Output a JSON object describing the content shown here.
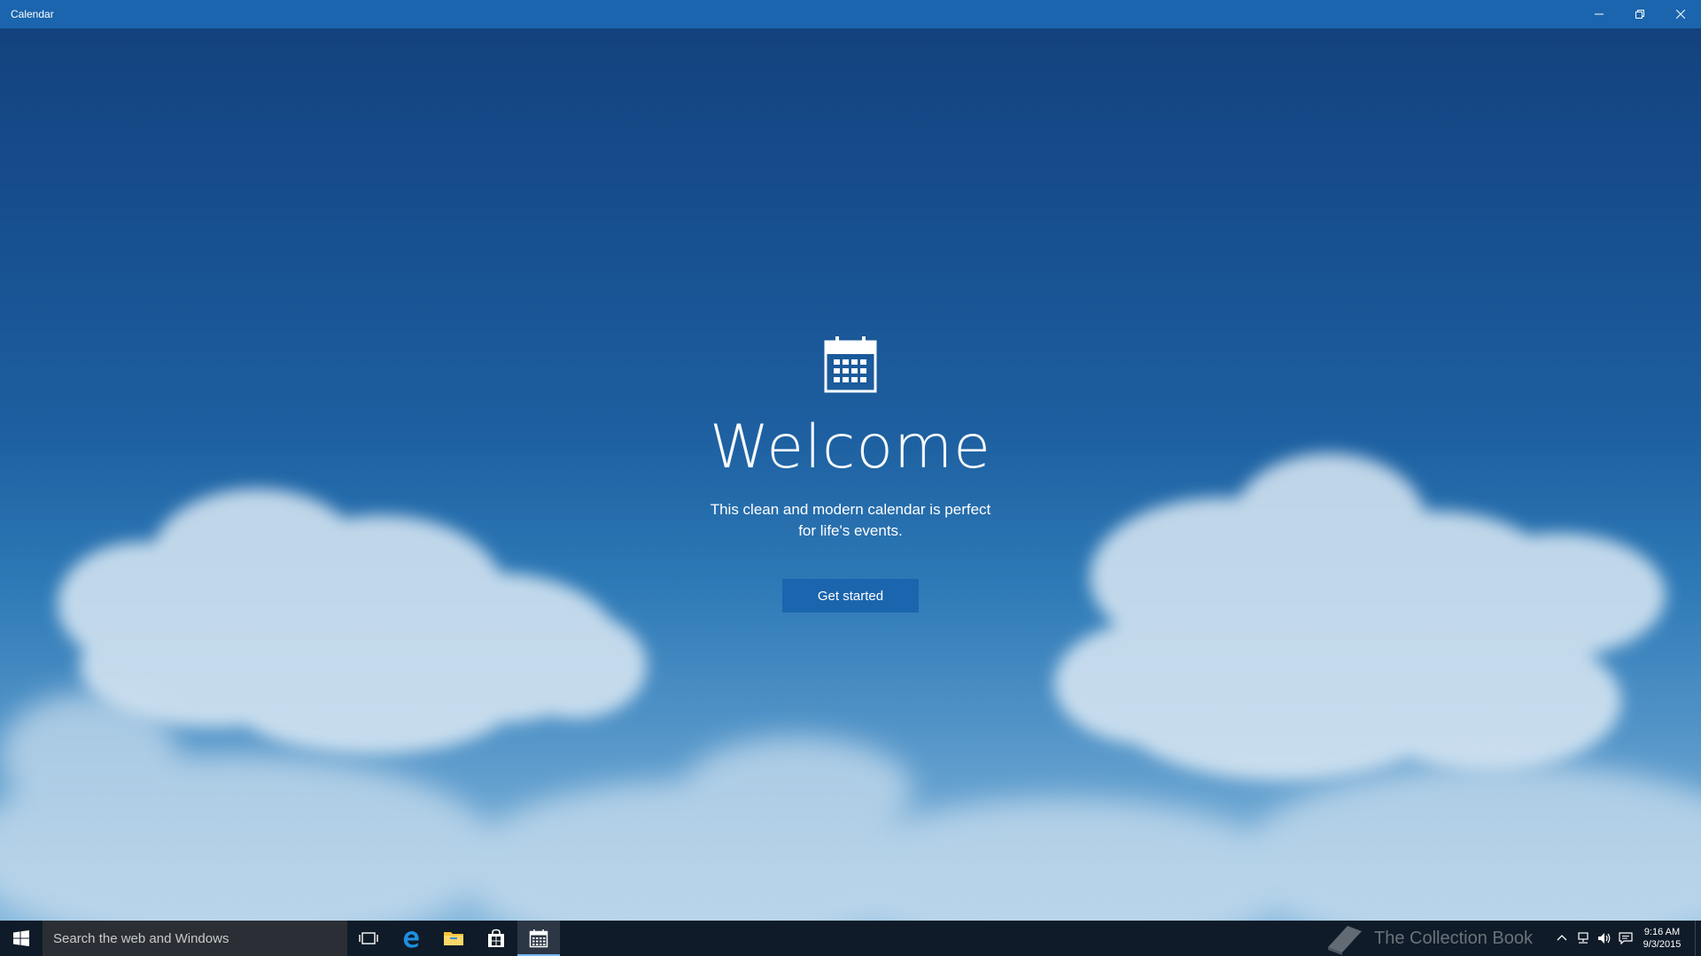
{
  "window": {
    "title": "Calendar",
    "controls": [
      "minimize",
      "restore",
      "close"
    ]
  },
  "welcome": {
    "icon": "calendar-icon",
    "headline": "Welcome",
    "subtitle_line1": "This clean and modern calendar is perfect",
    "subtitle_line2": "for life's events.",
    "button_label": "Get started"
  },
  "taskbar": {
    "search_placeholder": "Search the web and Windows",
    "pinned": [
      {
        "name": "task-view-icon"
      },
      {
        "name": "edge-icon"
      },
      {
        "name": "file-explorer-icon"
      },
      {
        "name": "store-icon"
      },
      {
        "name": "calendar-icon",
        "active": true
      }
    ],
    "watermark": "The Collection Book",
    "clock": {
      "time": "9:16 AM",
      "date": "9/3/2015"
    }
  },
  "colors": {
    "titlebar": "#1b65ae",
    "button": "#1b65ae",
    "taskbar": "#0f1b28",
    "search_box": "#2b2f35",
    "accent": "#76b9ed"
  }
}
